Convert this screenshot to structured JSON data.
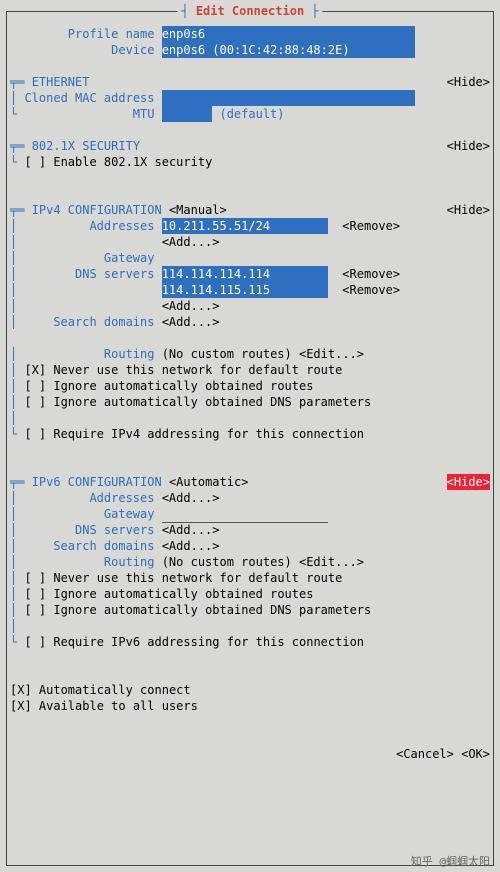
{
  "frame_title": "Edit Connection",
  "labels": {
    "profile_name": "Profile name",
    "device": "Device",
    "ethernet": "ETHERNET",
    "cloned_mac": "Cloned MAC address",
    "mtu": "MTU",
    "mtu_default": "(default)",
    "sec8021x": "802.1X SECURITY",
    "enable8021x": "Enable 802.1X security",
    "ipv4": "IPv4 CONFIGURATION",
    "ipv4_mode": "<Manual>",
    "addresses": "Addresses",
    "gateway": "Gateway",
    "dns": "DNS servers",
    "search": "Search domains",
    "routing": "Routing",
    "routing_val": "(No custom routes)",
    "edit": "<Edit...>",
    "add": "<Add...>",
    "remove": "<Remove>",
    "never_default": "Never use this network for default route",
    "ign_routes": "Ignore automatically obtained routes",
    "ign_dns": "Ignore automatically obtained DNS parameters",
    "req_v4": "Require IPv4 addressing for this connection",
    "ipv6": "IPv6 CONFIGURATION",
    "ipv6_mode": "<Automatic>",
    "req_v6": "Require IPv6 addressing for this connection",
    "auto_conn": "Automatically connect",
    "all_users": "Available to all users",
    "cancel": "<Cancel>",
    "ok": "<OK>",
    "hide": "<Hide>"
  },
  "values": {
    "profile_name": "enp0s6",
    "device": "enp0s6 (00:1C:42:88:48:2E)",
    "mtu": "",
    "ipv4_address": "10.211.55.51/24",
    "dns1": "114.114.114.114",
    "dns2": "114.114.115.115"
  },
  "checkboxes": {
    "enable8021x": false,
    "v4_never_default": true,
    "v4_ign_routes": false,
    "v4_ign_dns": false,
    "v4_require": false,
    "v6_never_default": false,
    "v6_ign_routes": false,
    "v6_ign_dns": false,
    "v6_require": false,
    "auto_conn": true,
    "all_users": true
  },
  "watermark": "知乎 @蝈蝈太阳"
}
